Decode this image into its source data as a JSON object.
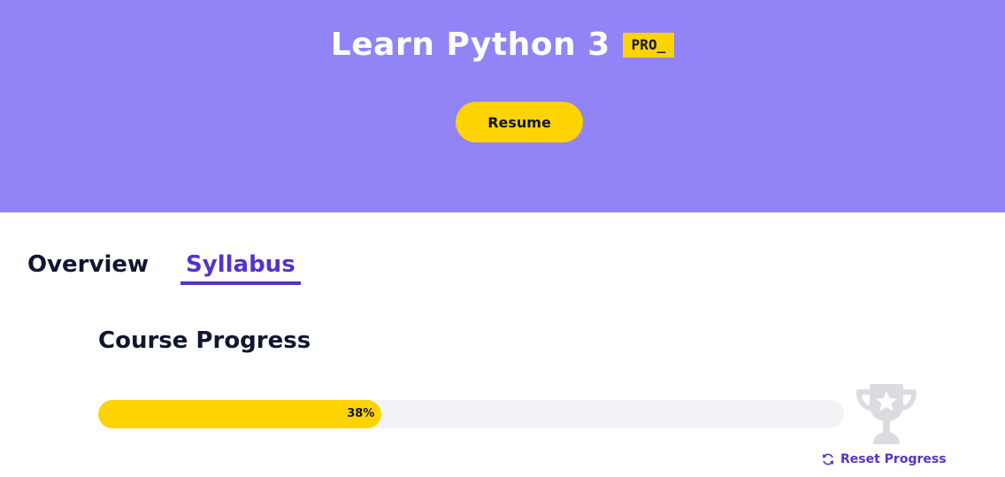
{
  "hero": {
    "title": "Learn Python 3",
    "badge": "PRO_",
    "resume_label": "Resume",
    "background_color": "#9184f6"
  },
  "tabs": [
    {
      "label": "Overview",
      "active": false
    },
    {
      "label": "Syllabus",
      "active": true
    }
  ],
  "progress": {
    "heading": "Course Progress",
    "percent": 38,
    "percent_label": "38%",
    "reset_label": "Reset Progress",
    "trophy_icon": "trophy-icon",
    "reset_icon": "refresh-icon"
  },
  "colors": {
    "accent": "#5533cc",
    "highlight": "#ffd300",
    "text": "#10162f"
  }
}
